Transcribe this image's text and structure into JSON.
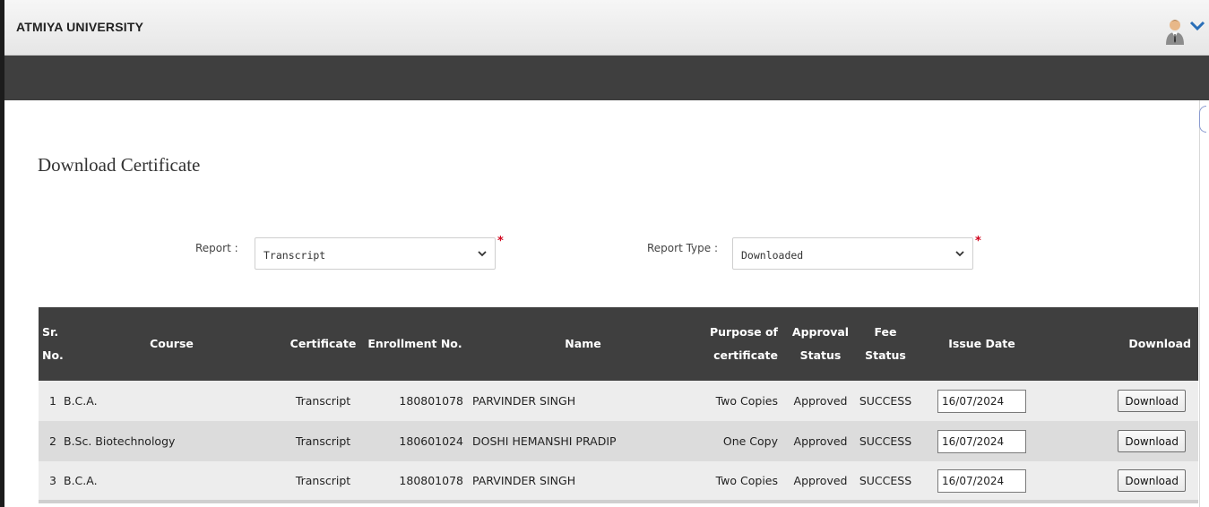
{
  "header": {
    "brand": "ATMIYA UNIVERSITY",
    "user_icon": "user-avatar-icon",
    "menu_icon": "chevron-down-icon"
  },
  "page": {
    "title": "Download Certificate"
  },
  "filters": {
    "report_label": "Report :",
    "report_value": "Transcript",
    "report_type_label": "Report Type :",
    "report_type_value": "Downloaded",
    "required_mark": "*"
  },
  "table": {
    "headers": {
      "sr": [
        "Sr.",
        "No."
      ],
      "course": "Course",
      "certificate": "Certificate",
      "enrollment": "Enrollment No.",
      "name": "Name",
      "purpose": [
        "Purpose of",
        "certificate"
      ],
      "approval": [
        "Approval",
        "Status"
      ],
      "fee": "Fee Status",
      "issue": "Issue Date",
      "download": "Download"
    },
    "rows": [
      {
        "sr": "1",
        "course": "B.C.A.",
        "certificate": "Transcript",
        "enrollment": "180801078",
        "name": "PARVINDER SINGH",
        "purpose": "Two Copies",
        "approval": "Approved",
        "fee": "SUCCESS",
        "issue_date": "16/07/2024",
        "download": "Download"
      },
      {
        "sr": "2",
        "course": "B.Sc. Biotechnology",
        "certificate": "Transcript",
        "enrollment": "180601024",
        "name": "DOSHI HEMANSHI PRADIP",
        "purpose": "One Copy",
        "approval": "Approved",
        "fee": "SUCCESS",
        "issue_date": "16/07/2024",
        "download": "Download"
      },
      {
        "sr": "3",
        "course": "B.C.A.",
        "certificate": "Transcript",
        "enrollment": "180801078",
        "name": "PARVINDER SINGH",
        "purpose": "Two Copies",
        "approval": "Approved",
        "fee": "SUCCESS",
        "issue_date": "16/07/2024",
        "download": "Download"
      }
    ]
  },
  "colors": {
    "navbar": "#3f3f3f",
    "table_header": "#3f3f3f",
    "row_light": "#ededed",
    "row_dark": "#dcdcdc",
    "required": "#d0021b",
    "chevron": "#2a6fb8"
  }
}
